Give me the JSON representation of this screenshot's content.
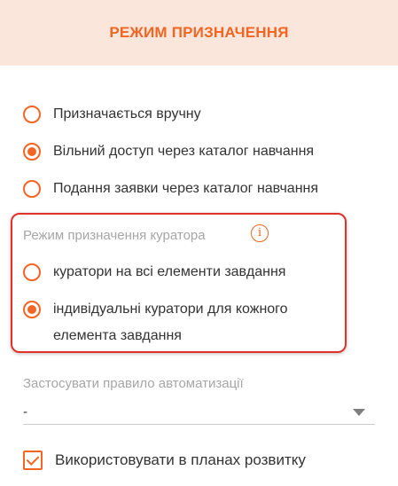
{
  "header": {
    "title": "РЕЖИМ ПРИЗНАЧЕННЯ"
  },
  "assignment_mode": {
    "options": [
      {
        "label": "Призначається вручну",
        "checked": false
      },
      {
        "label": "Вільний доступ через каталог навчання",
        "checked": true
      },
      {
        "label": "Подання заявки через каталог навчання",
        "checked": false
      }
    ]
  },
  "curator_mode": {
    "label": "Режим призначення куратора",
    "info_icon": "info-icon",
    "options": [
      {
        "label": "куратори на всі елементи завдання",
        "checked": false
      },
      {
        "label_line1": "індивідуальні куратори для кожного",
        "label_line2": "елемента завдання",
        "checked": true
      }
    ]
  },
  "automation": {
    "label": "Застосувати правило автоматизації",
    "value": "-"
  },
  "development_plans": {
    "label": "Використовувати в планах розвитку",
    "checked": true
  },
  "colors": {
    "accent": "#f26522",
    "header_bg": "#fbe6dc",
    "highlight_border": "#e0312b"
  }
}
